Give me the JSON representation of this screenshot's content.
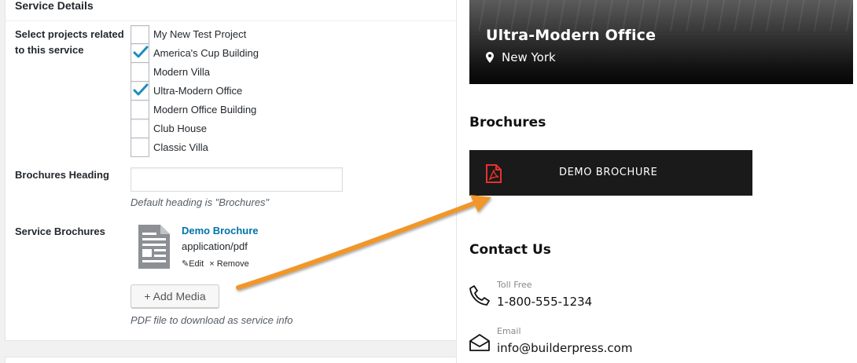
{
  "admin": {
    "section_title": "Service Details",
    "projects_label_line1": "Select projects related",
    "projects_label_line2": "to this service",
    "projects": [
      {
        "label": "My New Test Project",
        "checked": false
      },
      {
        "label": "America's Cup Building",
        "checked": true
      },
      {
        "label": "Modern Villa",
        "checked": false
      },
      {
        "label": "Ultra-Modern Office",
        "checked": true
      },
      {
        "label": "Modern Office Building",
        "checked": false
      },
      {
        "label": "Club House",
        "checked": false
      },
      {
        "label": "Classic Villa",
        "checked": false
      }
    ],
    "brochures_heading_label": "Brochures Heading",
    "brochures_heading_value": "",
    "brochures_heading_desc": "Default heading is \"Brochures\"",
    "service_brochures_label": "Service Brochures",
    "file": {
      "name": "Demo Brochure",
      "mime": "application/pdf",
      "edit_label": "Edit",
      "remove_label": "Remove"
    },
    "add_media_label": "+ Add Media",
    "brochures_desc": "PDF file to download as service info"
  },
  "front": {
    "hero_title": "Ultra-Modern Office",
    "hero_location": "New York",
    "brochures_heading": "Brochures",
    "brochure_button_label": "DEMO BROCHURE",
    "contact_heading": "Contact Us",
    "contacts": [
      {
        "label": "Toll Free",
        "value": "1-800-555-1234",
        "icon": "phone-icon"
      },
      {
        "label": "Email",
        "value": "info@builderpress.com",
        "icon": "envelope-icon"
      }
    ]
  },
  "colors": {
    "link": "#0073aa",
    "checkmark": "#1e8cbe",
    "arrow": "#f0962a",
    "pdf_icon": "#e8322b",
    "button_bg": "#1a1a1a"
  }
}
